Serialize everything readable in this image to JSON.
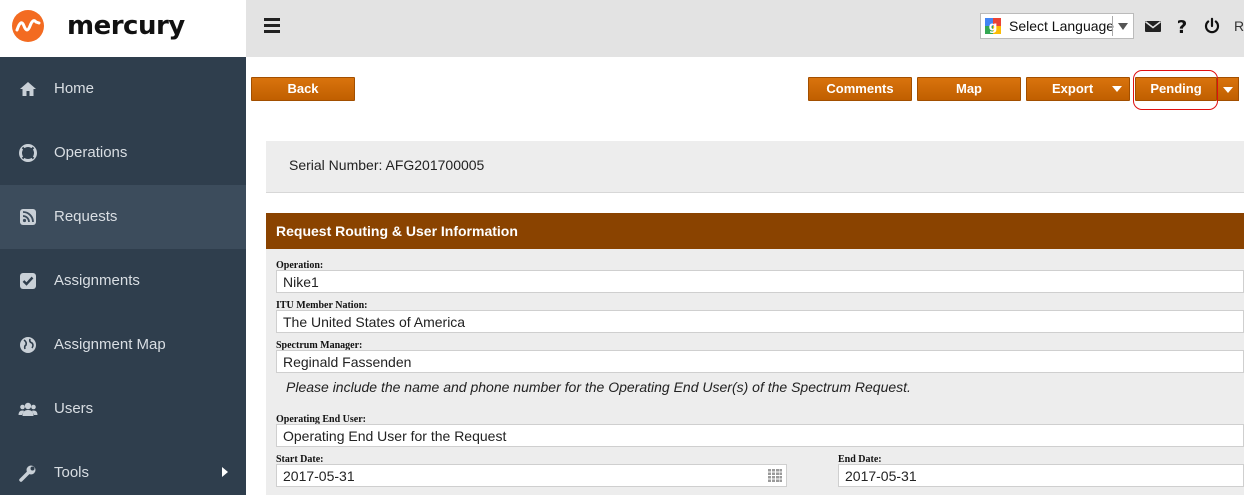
{
  "brand": {
    "name": "mercury",
    "logo_icon": "mercury-wave-logo",
    "logo_color": "#f36b21"
  },
  "sidebar": {
    "items": [
      {
        "label": "Home",
        "icon": "home-icon"
      },
      {
        "label": "Operations",
        "icon": "lifebuoy-icon"
      },
      {
        "label": "Requests",
        "icon": "rss-icon",
        "active": true
      },
      {
        "label": "Assignments",
        "icon": "checkbox-icon"
      },
      {
        "label": "Assignment Map",
        "icon": "globe-icon"
      },
      {
        "label": "Users",
        "icon": "users-icon"
      },
      {
        "label": "Tools",
        "icon": "wrench-icon",
        "has_submenu": true
      }
    ]
  },
  "topbar": {
    "menu_icon": "hamburger-icon",
    "language": {
      "label": "Select Language",
      "icon": "google-icon"
    },
    "icons": [
      "envelope-icon",
      "help-icon",
      "power-icon"
    ],
    "user_initial": "R"
  },
  "toolbar": {
    "back_label": "Back",
    "comments_label": "Comments",
    "map_label": "Map",
    "export_label": "Export",
    "status_label": "Pending",
    "accent_color": "#c86406"
  },
  "serial": {
    "text": "Serial Number: AFG201700005"
  },
  "section": {
    "title": "Request Routing & User Information",
    "header_color": "#8a4300",
    "operation": {
      "label": "Operation:",
      "value": "Nike1"
    },
    "member_nation": {
      "label": "ITU Member Nation:",
      "value": "The United States of America"
    },
    "spectrum_manager": {
      "label": "Spectrum Manager:",
      "value": "Reginald Fassenden"
    },
    "hint": "Please include the name and phone number for the Operating End User(s) of the Spectrum Request.",
    "end_user": {
      "label": "Operating End User:",
      "value": "Operating End User for the Request"
    },
    "start_date": {
      "label": "Start Date:",
      "value": "2017-05-31"
    },
    "end_date": {
      "label": "End Date:",
      "value": "2017-05-31"
    }
  }
}
